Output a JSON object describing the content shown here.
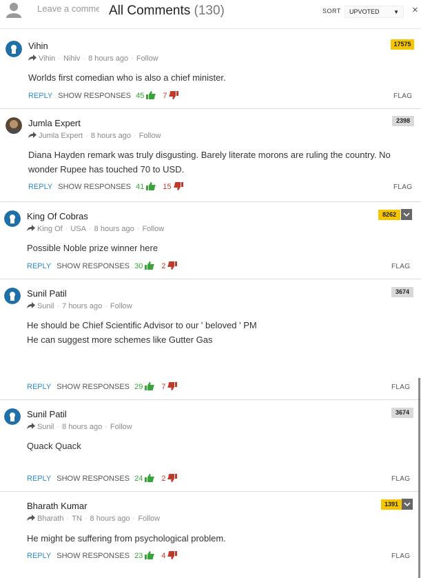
{
  "header": {
    "input_placeholder": "Leave a comment",
    "title": "All Comments",
    "count": "(130)",
    "sort_label": "SORT",
    "sort_value": "UPVOTED",
    "close": "×"
  },
  "actions_labels": {
    "reply": "REPLY",
    "show": "SHOW RESPONSES",
    "flag": "FLAG"
  },
  "comments": [
    {
      "name": "Vihin",
      "meta_user": "Vihin",
      "meta_loc": "Nihiv",
      "time": "8 hours ago",
      "follow": "Follow",
      "body": "Worlds first comedian who is also a chief minister.",
      "responses": "45",
      "up": "",
      "down": "7",
      "score": "17575",
      "badge": "gold",
      "avatar": "blue"
    },
    {
      "name": "Jumla Expert",
      "meta_user": "Jumla Expert",
      "meta_loc": "",
      "time": "8 hours ago",
      "follow": "Follow",
      "body": "Diana Hayden remark was truly disgusting. Barely literate morons are ruling the country. No wonder Rupee has touched 70 to USD.",
      "responses": "41",
      "up": "",
      "down": "15",
      "score": "2398",
      "badge": "grey",
      "avatar": "photo"
    },
    {
      "name": "King Of Cobras",
      "meta_user": "King Of",
      "meta_loc": "USA",
      "time": "8 hours ago",
      "follow": "Follow",
      "body": "Possible Noble prize winner here",
      "responses": "30",
      "up": "",
      "down": "2",
      "score": "8262",
      "badge": "gold",
      "avatar": "blue"
    },
    {
      "name": "Sunil Patil",
      "meta_user": "Sunil",
      "meta_loc": "",
      "time": "7 hours ago",
      "follow": "Follow",
      "body_lines": [
        "He should be Chief Scientific Advisor to our ' beloved ' PM",
        "He can suggest more schemes like Gutter Gas"
      ],
      "responses": "29",
      "up": "",
      "down": "7",
      "score": "3674",
      "badge": "grey",
      "avatar": "blue"
    },
    {
      "name": "Sunil Patil",
      "meta_user": "Sunil",
      "meta_loc": "",
      "time": "8 hours ago",
      "follow": "Follow",
      "body": "Quack Quack",
      "responses": "24",
      "up": "",
      "down": "2",
      "score": "3674",
      "badge": "grey",
      "avatar": "blue"
    },
    {
      "name": "Bharath Kumar",
      "meta_user": "Bharath",
      "meta_loc": "TN",
      "time": "8 hours ago",
      "follow": "Follow",
      "body": "He might be suffering from psychological problem.",
      "responses": "23",
      "up": "",
      "down": "4",
      "score": "1391",
      "badge": "gold",
      "avatar": "none"
    }
  ],
  "colors": {
    "accent": "#2e89c8",
    "upvote": "#3aa43a",
    "downvote": "#c0392b",
    "badge_gold": "#f7c400",
    "badge_grey": "#d9d9d9"
  },
  "icons": {
    "user_placeholder": "user-placeholder-icon",
    "share": "share-arrow-icon",
    "like": "thumbs-up-icon",
    "dislike": "thumbs-down-icon",
    "caret": "caret-down-icon",
    "close": "close-icon"
  }
}
